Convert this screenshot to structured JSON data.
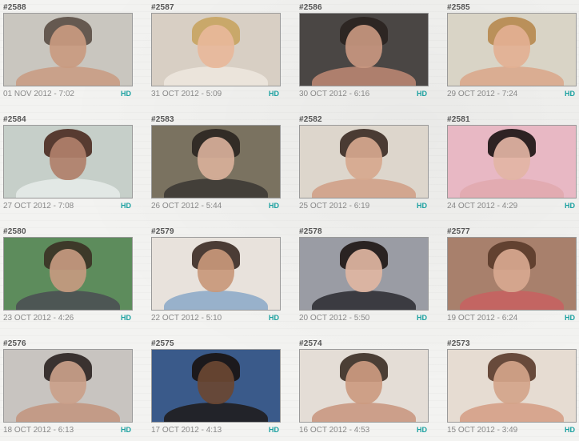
{
  "tiles": [
    {
      "id": "#2588",
      "date": "01 NOV 2012 - 7:02",
      "badge": "HD",
      "bg": "#c9c6bf",
      "face": "#c99a80",
      "hair": "#5a4c44",
      "body": "#c99a80"
    },
    {
      "id": "#2587",
      "date": "31 OCT 2012 - 5:09",
      "badge": "HD",
      "bg": "#d8cfc4",
      "face": "#e8b89a",
      "hair": "#c8a360",
      "body": "#efe7df"
    },
    {
      "id": "#2586",
      "date": "30 OCT 2012 - 6:16",
      "badge": "HD",
      "bg": "#4a4644",
      "face": "#c89780",
      "hair": "#2a2220",
      "body": "#c08a74"
    },
    {
      "id": "#2585",
      "date": "29 OCT 2012 - 7:24",
      "badge": "HD",
      "bg": "#d9d4c6",
      "face": "#e3b092",
      "hair": "#b6884e",
      "body": "#d9a688"
    },
    {
      "id": "#2584",
      "date": "27 OCT 2012 - 7:08",
      "badge": "HD",
      "bg": "#c6cfc9",
      "face": "#b0806a",
      "hair": "#4a2a20",
      "body": "#e6ecea"
    },
    {
      "id": "#2583",
      "date": "26 OCT 2012 - 5:44",
      "badge": "HD",
      "bg": "#7a7260",
      "face": "#d8b09a",
      "hair": "#2a2520",
      "body": "#3a3632"
    },
    {
      "id": "#2582",
      "date": "25 OCT 2012 - 6:19",
      "badge": "HD",
      "bg": "#ddd6cc",
      "face": "#d6a88e",
      "hair": "#3a2a22",
      "body": "#d09e84"
    },
    {
      "id": "#2581",
      "date": "24 OCT 2012 - 4:29",
      "badge": "HD",
      "bg": "#e8b8c4",
      "face": "#e2b4a4",
      "hair": "#1a1212",
      "body": "#e0a8ae"
    },
    {
      "id": "#2580",
      "date": "23 OCT 2012 - 4:26",
      "badge": "HD",
      "bg": "#5d8c5c",
      "face": "#c69a80",
      "hair": "#3a3024",
      "body": "#4a4c52"
    },
    {
      "id": "#2579",
      "date": "22 OCT 2012 - 5:10",
      "badge": "HD",
      "bg": "#e8e2dc",
      "face": "#c8987a",
      "hair": "#3a2a22",
      "body": "#8aa8c8"
    },
    {
      "id": "#2578",
      "date": "20 OCT 2012 - 5:50",
      "badge": "HD",
      "bg": "#9a9ca4",
      "face": "#e0b6a2",
      "hair": "#1e1614",
      "body": "#2a2a30"
    },
    {
      "id": "#2577",
      "date": "19 OCT 2012 - 6:24",
      "badge": "HD",
      "bg": "#a8806c",
      "face": "#d8a890",
      "hair": "#5a3a2a",
      "body": "#c86060"
    },
    {
      "id": "#2576",
      "date": "18 OCT 2012 - 6:13",
      "badge": "HD",
      "bg": "#c8c4c0",
      "face": "#caa08a",
      "hair": "#2a2220",
      "body": "#c2947c"
    },
    {
      "id": "#2575",
      "date": "17 OCT 2012 - 4:13",
      "badge": "HD",
      "bg": "#3a5a8a",
      "face": "#6a4632",
      "hair": "#1a1210",
      "body": "#1e1a18"
    },
    {
      "id": "#2574",
      "date": "16 OCT 2012 - 4:53",
      "badge": "HD",
      "bg": "#e4ddd6",
      "face": "#cc9a80",
      "hair": "#3a2c24",
      "body": "#c8947c"
    },
    {
      "id": "#2573",
      "date": "15 OCT 2012 - 3:49",
      "badge": "HD",
      "bg": "#e6dcd2",
      "face": "#d4a48a",
      "hair": "#5a3a2a",
      "body": "#d49c84"
    }
  ]
}
